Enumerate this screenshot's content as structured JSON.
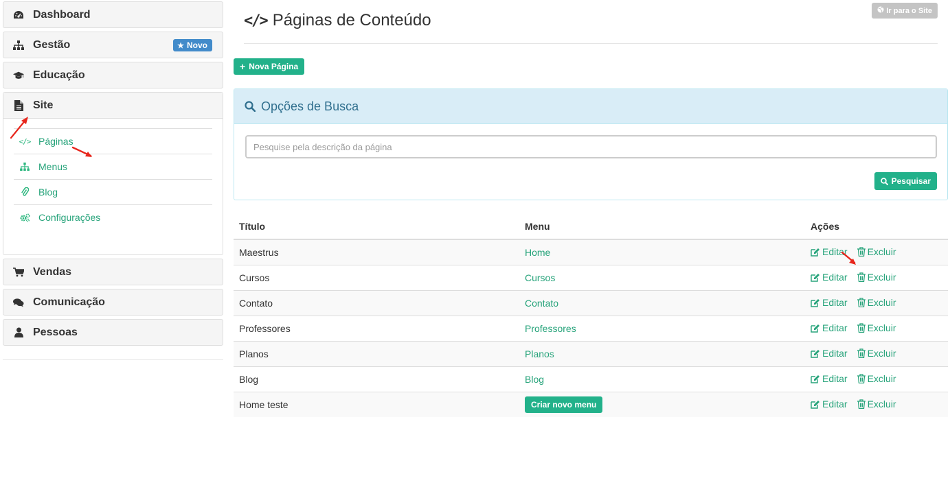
{
  "sidebar": {
    "items_top": [
      {
        "label": "Dashboard",
        "icon": "dashboard-icon"
      },
      {
        "label": "Gestão",
        "icon": "sitemap-icon",
        "badge": "Novo"
      },
      {
        "label": "Educação",
        "icon": "graduation-cap-icon"
      }
    ],
    "site": {
      "label": "Site",
      "icon": "file-icon",
      "sub_items": [
        {
          "label": "Páginas",
          "icon": "code-icon"
        },
        {
          "label": "Menus",
          "icon": "sitemap-icon"
        },
        {
          "label": "Blog",
          "icon": "paperclip-icon"
        },
        {
          "label": "Configurações",
          "icon": "gears-icon"
        }
      ]
    },
    "items_bottom": [
      {
        "label": "Vendas",
        "icon": "cart-icon"
      },
      {
        "label": "Comunicação",
        "icon": "comments-icon"
      },
      {
        "label": "Pessoas",
        "icon": "user-icon"
      }
    ]
  },
  "header": {
    "title": "Páginas de Conteúdo",
    "title_icon": "</>",
    "goto_site_label": "Ir para o Site"
  },
  "toolbar": {
    "new_page_label": "Nova Página"
  },
  "search": {
    "heading": "Opções de Busca",
    "placeholder": "Pesquise pela descrição da página",
    "button_label": "Pesquisar"
  },
  "table": {
    "columns": [
      "Título",
      "Menu",
      "Ações"
    ],
    "edit_label": "Editar",
    "delete_label": "Excluir",
    "create_menu_label": "Criar novo menu",
    "rows": [
      {
        "title": "Maestrus",
        "menu": "Home"
      },
      {
        "title": "Cursos",
        "menu": "Cursos"
      },
      {
        "title": "Contato",
        "menu": "Contato"
      },
      {
        "title": "Professores",
        "menu": "Professores"
      },
      {
        "title": "Planos",
        "menu": "Planos"
      },
      {
        "title": "Blog",
        "menu": "Blog"
      },
      {
        "title": "Home teste",
        "menu": ""
      }
    ]
  },
  "colors": {
    "accent": "#22b18a",
    "link": "#26a37a",
    "info_bg": "#d9edf7",
    "badge": "#428bca",
    "annotation": "#e8261c"
  }
}
